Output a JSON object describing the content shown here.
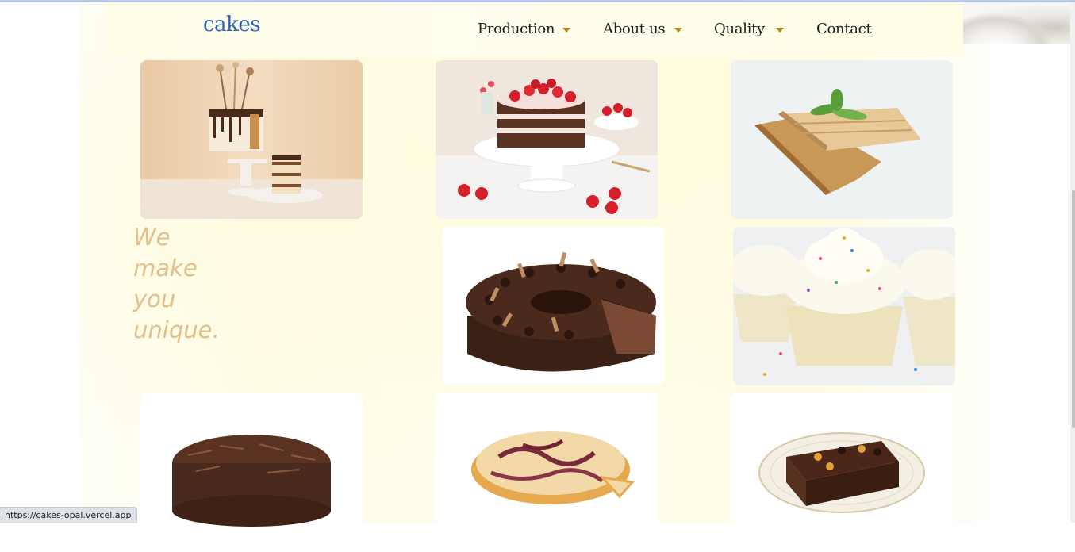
{
  "header": {
    "brand": "cakes",
    "nav": [
      {
        "label": "Production",
        "has_dropdown": true
      },
      {
        "label": "About us",
        "has_dropdown": true
      },
      {
        "label": "Quality",
        "has_dropdown": true
      },
      {
        "label": "Contact",
        "has_dropdown": false
      }
    ]
  },
  "hero": {
    "tagline_lines": [
      "We",
      "make",
      "you",
      "unique."
    ]
  },
  "gallery": [
    {
      "icon": "drip-cake-icon"
    },
    {
      "icon": "strawberry-cake-icon"
    },
    {
      "icon": "crispy-slice-icon"
    },
    {
      "icon": "chocolate-torte-icon"
    },
    {
      "icon": "cupcakes-icon"
    },
    {
      "icon": "chocolate-shaving-cake-icon"
    },
    {
      "icon": "marble-cheesecake-icon"
    },
    {
      "icon": "brownie-icon"
    }
  ],
  "status_bar": {
    "url": "https://cakes-opal.vercel.app"
  },
  "colors": {
    "brand": "#2e63b8",
    "nav_caret": "#b8860b",
    "tagline": "#e2bf8b",
    "page_background": "#fffde8"
  }
}
